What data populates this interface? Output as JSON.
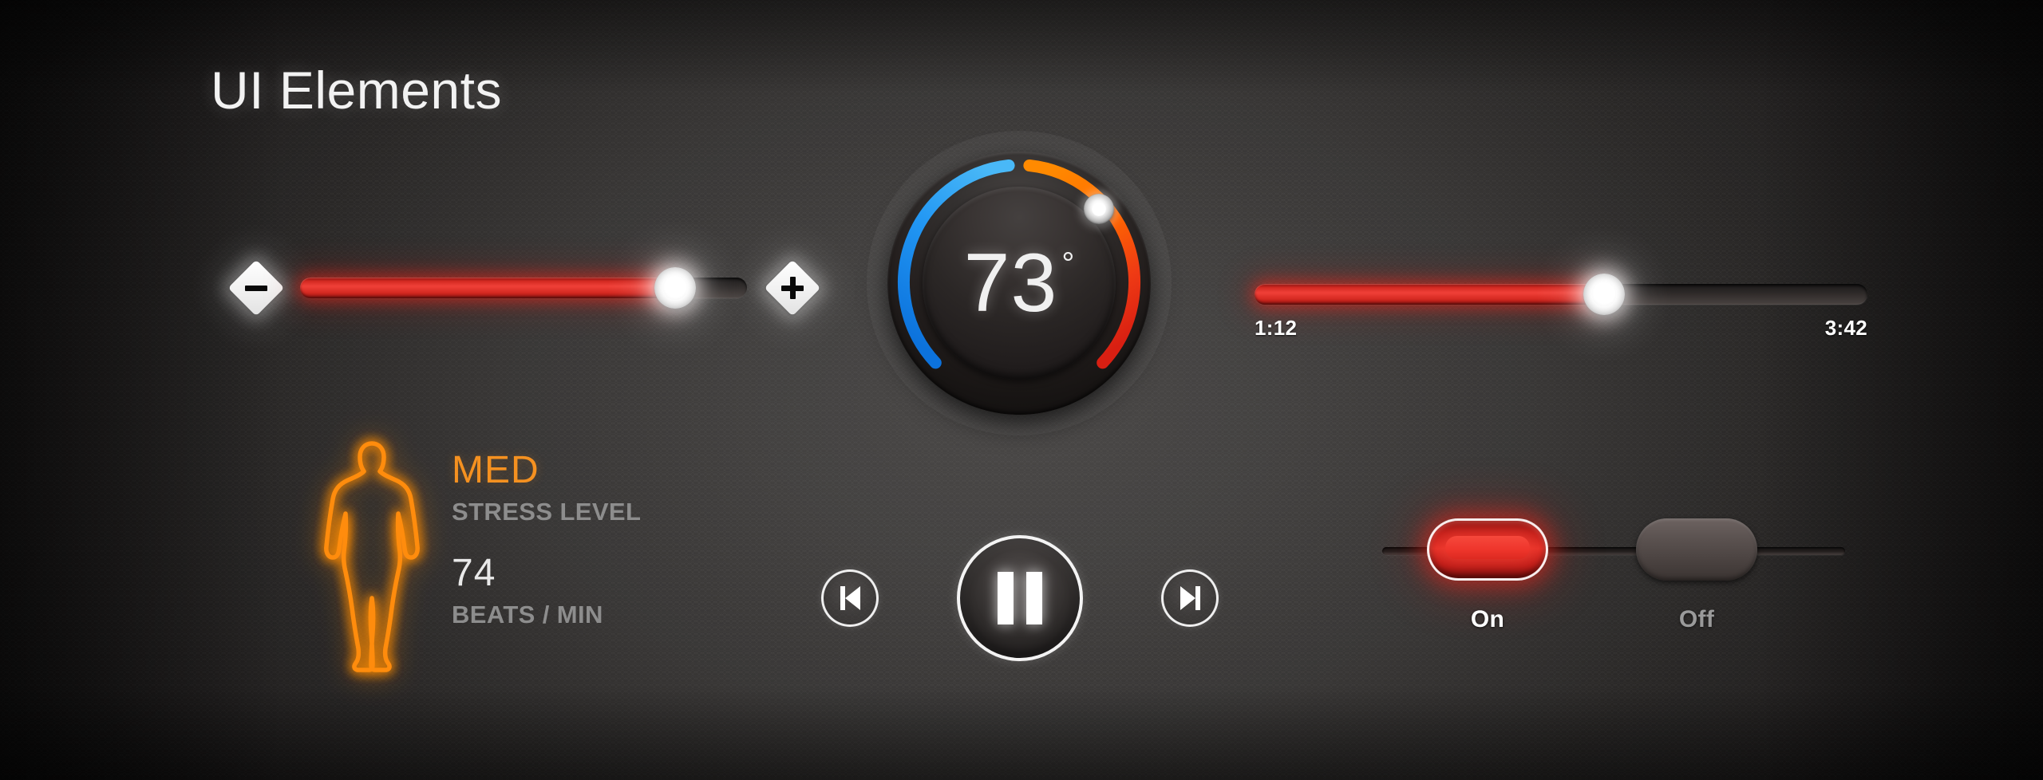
{
  "page": {
    "title": "UI Elements"
  },
  "theme": {
    "accent_red": "#e63229",
    "accent_orange": "#ff8c0a",
    "accent_blue": "#2196f3",
    "background_center": "#4e4c4b",
    "background_edge": "#0e0d0d",
    "text_primary": "#f2f2f2",
    "text_muted": "#8d8d8d"
  },
  "volume_slider": {
    "name": "volume-slider",
    "decrease_icon": "minus-icon",
    "increase_icon": "plus-icon",
    "value_percent": 84,
    "knob_icon": "slider-knob-icon"
  },
  "thermostat": {
    "value": "73",
    "unit": "°",
    "cold_arc_color": "#2196f3",
    "warm_arc_color": "#ff6a00",
    "hot_arc_color": "#e02914",
    "knob_angle_degrees": 42,
    "cold_arc_start_deg": -8,
    "cold_arc_end_deg": -140,
    "warm_arc_start_deg": 8,
    "warm_arc_end_deg": 140
  },
  "progress_slider": {
    "name": "playback-progress-slider",
    "elapsed": "1:12",
    "total": "3:42",
    "value_percent": 57
  },
  "biometrics": {
    "figure_icon": "human-body-icon",
    "stress_value": "MED",
    "stress_label": "STRESS LEVEL",
    "heart_rate_value": "74",
    "heart_rate_label": "BEATS / MIN"
  },
  "media_controls": {
    "previous_icon": "previous-track-icon",
    "play_pause_icon": "pause-icon",
    "next_icon": "next-track-icon",
    "state": "playing"
  },
  "power_toggle": {
    "name": "power-toggle",
    "on_label": "On",
    "off_label": "Off",
    "selected": "On"
  }
}
